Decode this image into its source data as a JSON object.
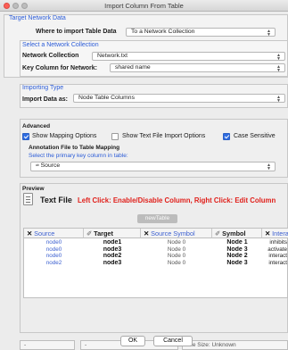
{
  "window": {
    "title": "Import Column From Table"
  },
  "target": {
    "header": "Target Network Data",
    "where_label": "Where to import Table Data",
    "where_value": "To a Network Collection",
    "collection_header": "Select a Network Collection",
    "collection_label": "Network Collection",
    "collection_value": "Network.txt",
    "key_label": "Key Column for Network:",
    "key_value": "shared name"
  },
  "importing": {
    "header": "Importing Type",
    "label": "Import Data as:",
    "value": "Node Table Columns"
  },
  "advanced": {
    "header": "Advanced",
    "show_mapping": {
      "label": "Show Mapping Options",
      "checked": true
    },
    "show_text_file": {
      "label": "Show Text File Import Options",
      "checked": false
    },
    "case_sensitive": {
      "label": "Case Sensitive",
      "checked": true
    },
    "mapping_title": "Annotation File to Table Mapping",
    "mapping_hint": "Select the primary key column in table:",
    "primary_key_value": "Source",
    "primary_key_icon": "column-a-b-icon"
  },
  "preview": {
    "header": "Preview",
    "icon": "text-file-icon",
    "file_type": "Text File",
    "instruction": "Left Click: Enable/Disable Column, Right Click: Edit Column",
    "table_name": "newTable",
    "columns": [
      {
        "label": "Source",
        "icon": "x-icon",
        "enabled": false
      },
      {
        "label": "Target",
        "icon": "check-icon",
        "enabled": true
      },
      {
        "label": "Source Symbol",
        "icon": "x-icon",
        "enabled": false
      },
      {
        "label": "Symbol",
        "icon": "check-icon",
        "enabled": true
      },
      {
        "label": "Interacti",
        "icon": "x-icon",
        "enabled": false
      }
    ],
    "rows": [
      [
        "node0",
        "node1",
        "Node 0",
        "Node 1",
        "inhibits"
      ],
      [
        "node0",
        "node3",
        "Node 0",
        "Node 3",
        "activate"
      ],
      [
        "node0",
        "node2",
        "Node 0",
        "Node 2",
        "interact"
      ],
      [
        "node2",
        "node3",
        "Node 0",
        "Node 3",
        "interact"
      ]
    ]
  },
  "status": {
    "box1": "-",
    "box2": "-",
    "file_size": "File Size: Unknown"
  },
  "buttons": {
    "ok": "OK",
    "cancel": "Cancel"
  },
  "colors": {
    "accent": "#2a5bd7",
    "error_text": "#e0201b",
    "disabled_text": "#3b5fd0"
  }
}
